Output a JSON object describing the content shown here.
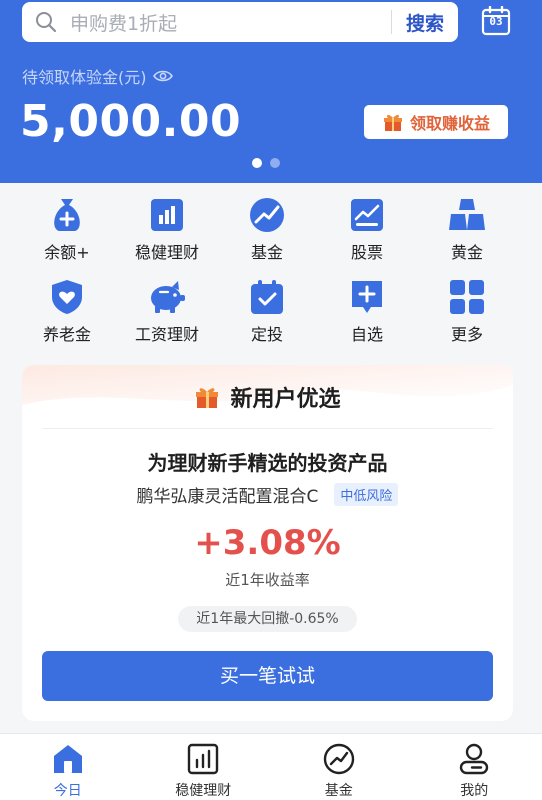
{
  "colors": {
    "brand": "#3b6fe0",
    "accent_orange": "#e0633a",
    "rate_red": "#e4504b"
  },
  "search": {
    "placeholder": "申购费1折起",
    "button": "搜索",
    "calendar_day": "03"
  },
  "balance": {
    "label": "待领取体验金(元)",
    "value": "5,000.00",
    "claim_button": "领取赚收益"
  },
  "carousel": {
    "pages": 2,
    "active": 0
  },
  "grid": [
    {
      "label": "余额+",
      "icon": "money-bag-icon"
    },
    {
      "label": "稳健理财",
      "icon": "bar-chart-icon"
    },
    {
      "label": "基金",
      "icon": "trend-circle-icon"
    },
    {
      "label": "股票",
      "icon": "stock-chart-icon"
    },
    {
      "label": "黄金",
      "icon": "gold-bars-icon"
    },
    {
      "label": "养老金",
      "icon": "heart-shield-icon"
    },
    {
      "label": "工资理财",
      "icon": "piggy-bank-icon"
    },
    {
      "label": "定投",
      "icon": "calendar-check-icon"
    },
    {
      "label": "自选",
      "icon": "add-bookmark-icon"
    },
    {
      "label": "更多",
      "icon": "more-grid-icon"
    }
  ],
  "card": {
    "title": "新用户优选",
    "headline": "为理财新手精选的投资产品",
    "fund_name": "鹏华弘康灵活配置混合C",
    "risk_tag": "中低风险",
    "rate": "+3.08%",
    "rate_label": "近1年收益率",
    "drawdown": "近1年最大回撤-0.65%",
    "buy_button": "买一笔试试"
  },
  "tabs": [
    {
      "label": "今日",
      "icon": "home-icon",
      "active": true
    },
    {
      "label": "稳健理财",
      "icon": "bar-chart-icon",
      "active": false
    },
    {
      "label": "基金",
      "icon": "trend-circle-icon",
      "active": false
    },
    {
      "label": "我的",
      "icon": "user-icon",
      "active": false
    }
  ]
}
